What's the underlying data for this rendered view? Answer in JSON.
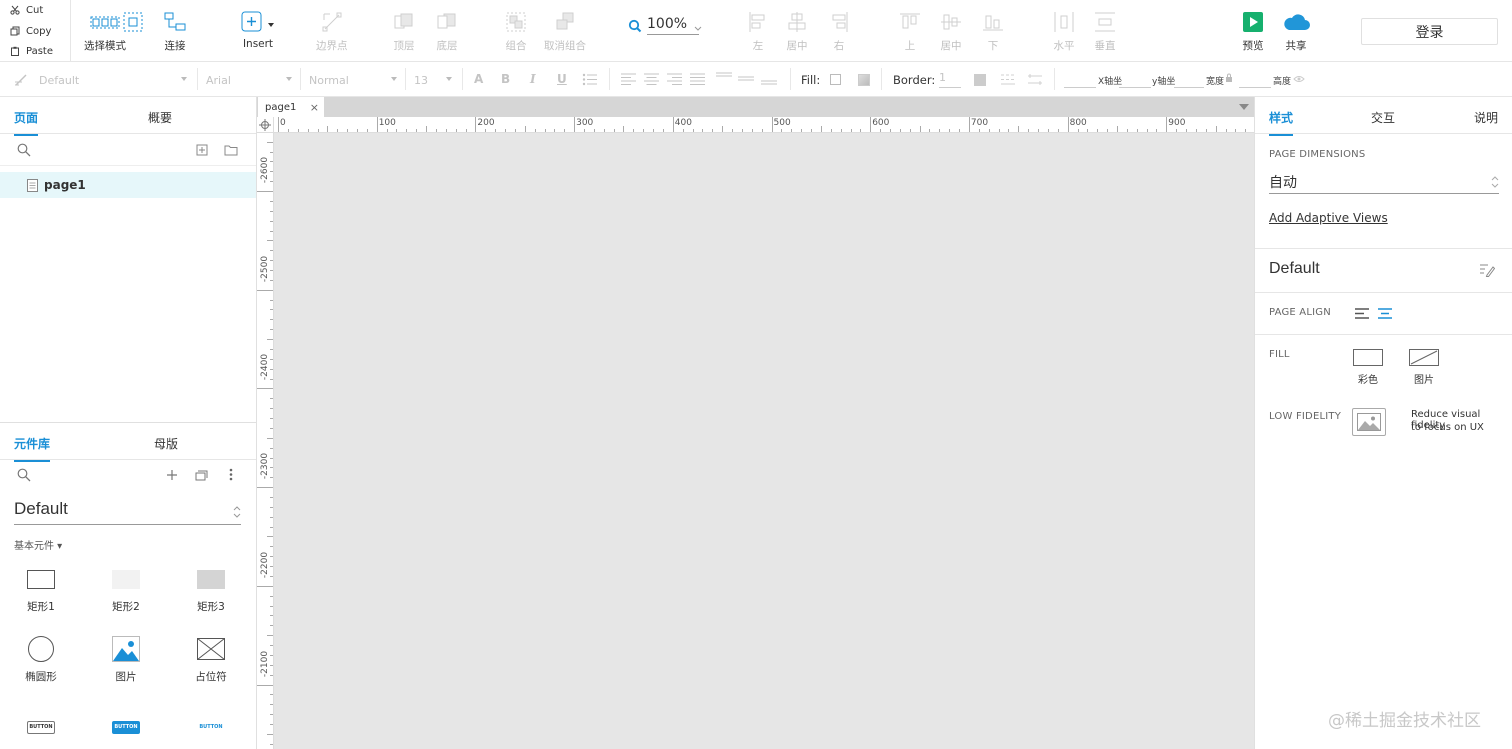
{
  "clipboard": {
    "cut": "Cut",
    "copy": "Copy",
    "paste": "Paste"
  },
  "toolbar": {
    "select_mode": "选择模式",
    "connect": "连接",
    "insert": "Insert",
    "edge_points": "边界点",
    "top_layer": "顶层",
    "bottom_layer": "底层",
    "group": "组合",
    "ungroup": "取消组合",
    "zoom": "100%",
    "align_left": "左",
    "align_center": "居中",
    "align_right": "右",
    "align_top": "上",
    "align_middle": "居中",
    "align_bottom": "下",
    "distribute_h": "水平",
    "distribute_v": "垂直",
    "preview": "预览",
    "share": "共享",
    "login": "登录"
  },
  "format": {
    "style": "Default",
    "font": "Arial",
    "weight": "Normal",
    "size": "13",
    "fill_label": "Fill:",
    "border_label": "Border:",
    "border_value": "1",
    "x_label": "X轴坐",
    "y_label": "y轴坐",
    "w_label": "宽度",
    "h_label": "高度"
  },
  "left": {
    "tabs": [
      "页面",
      "概要"
    ],
    "page_name": "page1",
    "lib_tabs": [
      "元件库",
      "母版"
    ],
    "library": "Default",
    "category": "基本元件",
    "widgets": [
      "矩形1",
      "矩形2",
      "矩形3",
      "椭圆形",
      "图片",
      "占位符"
    ],
    "button_text": "BUTTON"
  },
  "canvas": {
    "tab": "page1",
    "hticks": [
      "0",
      "100",
      "200",
      "300",
      "400",
      "500",
      "600",
      "700",
      "800",
      "900"
    ],
    "vticks": [
      "-2600",
      "-2500",
      "-2400",
      "-2300",
      "-2200",
      "-2100"
    ]
  },
  "right": {
    "tabs": [
      "样式",
      "交互",
      "说明"
    ],
    "page_dimensions_caption": "PAGE DIMENSIONS",
    "dimension_value": "自动",
    "adaptive_link": "Add Adaptive Views",
    "style_name": "Default",
    "page_align_caption": "PAGE ALIGN",
    "fill_caption": "FILL",
    "fill_color": "彩色",
    "fill_image": "图片",
    "low_fidelity_caption": "LOW FIDELITY",
    "low_fidelity_desc_1": "Reduce visual fidelity",
    "low_fidelity_desc_2": "to focus on UX"
  },
  "watermark": "@稀土掘金技术社区",
  "colors": {
    "accent": "#1a8fd6",
    "preview_green": "#16b06e",
    "cloud_blue": "#2196d8"
  }
}
